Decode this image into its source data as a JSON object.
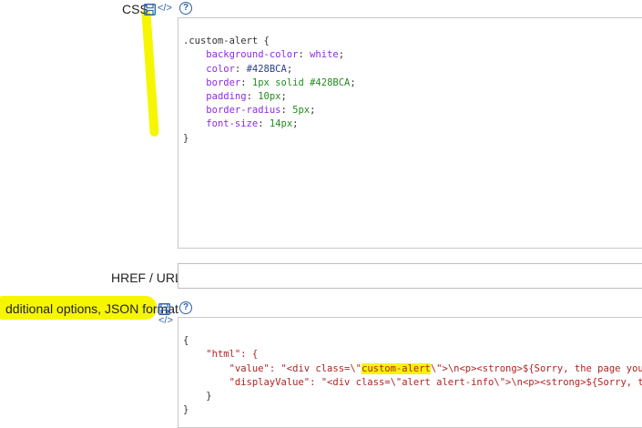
{
  "css_field": {
    "label": "CSS",
    "code_lines": [
      ".custom-alert {",
      "background-color",
      "white",
      "color",
      "#428BCA",
      "border",
      "1px solid #428BCA",
      "padding",
      "10px",
      "border-radius",
      "5px",
      "font-size",
      "14px",
      "}"
    ]
  },
  "href_field": {
    "label": "HREF / URL",
    "value": ""
  },
  "options_field": {
    "label": "dditional options, JSON format",
    "json": {
      "open": "{",
      "html_key": "\"html\": {",
      "value_key": "\"value\":",
      "value_prefix": "\"<div class=\\\"",
      "value_highlight": "custom-alert",
      "value_suffix": "\\\">\\n<p><strong>${Sorry, the page you reques",
      "display_key": "\"displayValue\":",
      "display_val": "\"<div class=\\\"alert alert-info\\\">\\n<p><strong>${Sorry, the page",
      "inner_close": "}",
      "close": "}"
    }
  },
  "icons": {
    "save": "save-icon",
    "code": "code-icon",
    "help": "help-icon",
    "help_glyph": "?",
    "code_glyph": "</>"
  },
  "colors": {
    "highlight": "#f6f600",
    "link_blue": "#2c5fa8"
  }
}
